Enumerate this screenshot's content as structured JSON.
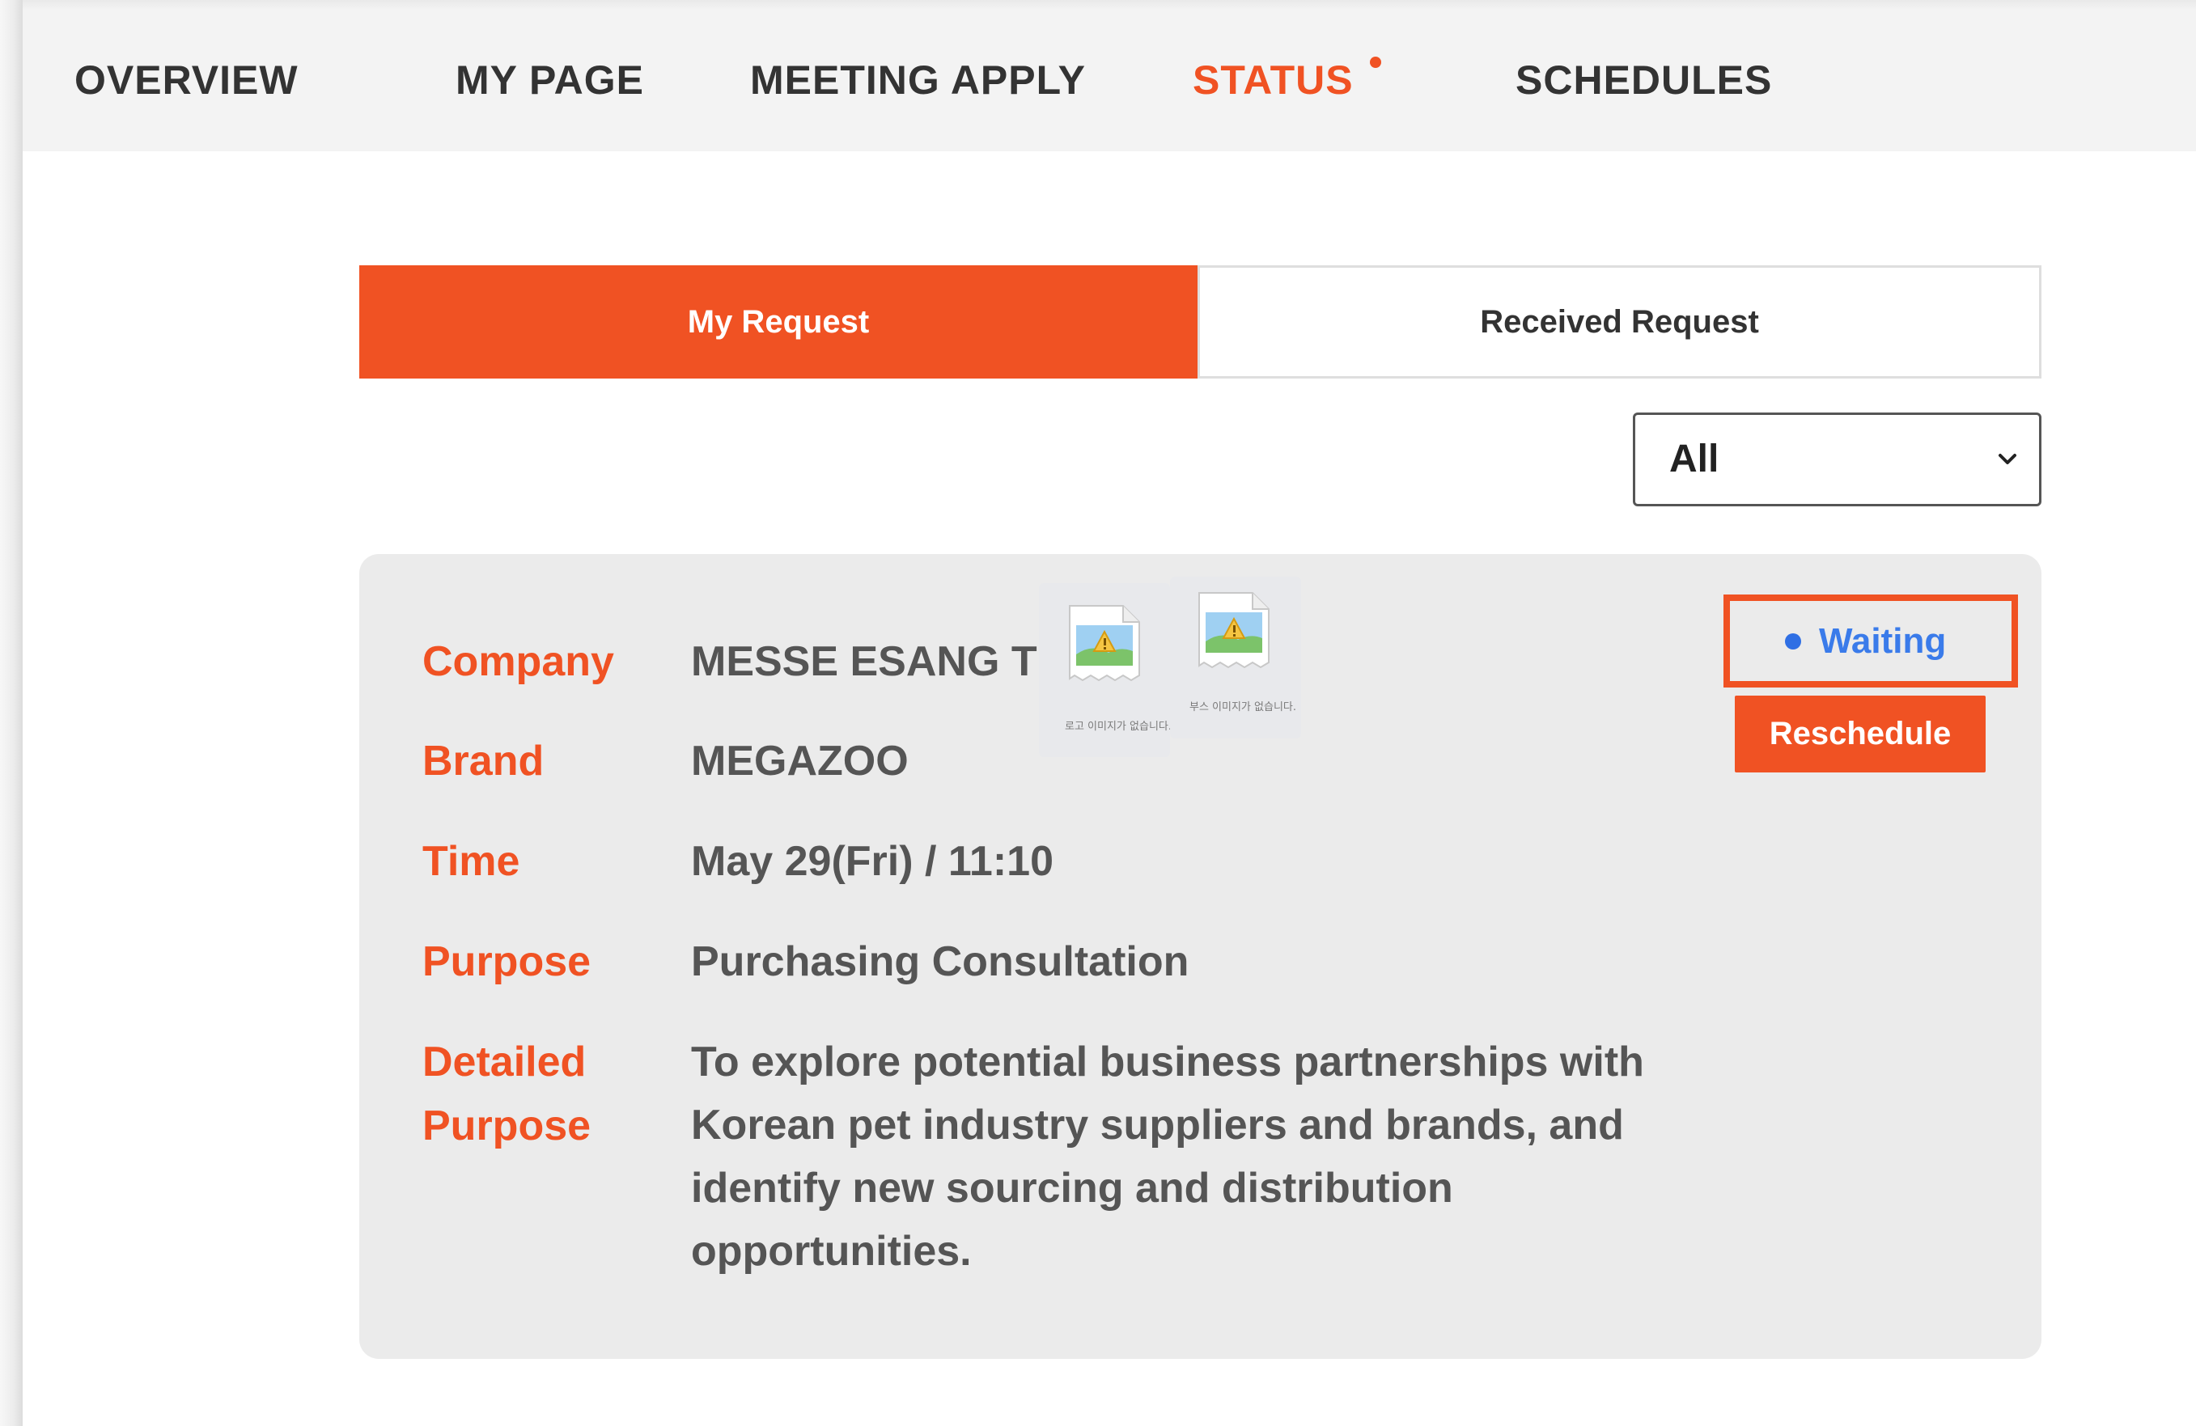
{
  "nav": {
    "items": [
      {
        "label": "OVERVIEW",
        "active": false
      },
      {
        "label": "MY PAGE",
        "active": false
      },
      {
        "label": "MEETING APPLY",
        "active": false
      },
      {
        "label": "STATUS",
        "active": true,
        "has_notification_dot": true
      },
      {
        "label": "SCHEDULES",
        "active": false
      }
    ]
  },
  "tabs": {
    "my_request": "My Request",
    "received_request": "Received Request",
    "active": "my_request"
  },
  "filter": {
    "selected": "All"
  },
  "request": {
    "labels": {
      "company": "Company",
      "brand": "Brand",
      "time": "Time",
      "purpose": "Purpose",
      "detailed_purpose_line1": "Detailed",
      "detailed_purpose_line2": "Purpose"
    },
    "values": {
      "company": "MESSE ESANG TES",
      "brand": "MEGAZOO",
      "time": "May 29(Fri) / 11:10",
      "purpose": "Purchasing Consultation",
      "detailed_purpose": "To explore potential business partnerships with Korean pet industry suppliers and brands, and identify new sourcing and distribution opportunities."
    },
    "broken_images": [
      {
        "icon": "broken-image-icon",
        "caption": "로고 이미지가 없습니다."
      },
      {
        "icon": "broken-image-icon",
        "caption": "부스 이미지가 없습니다."
      }
    ],
    "status": {
      "label": "Waiting",
      "dot_color": "#2f6fe4"
    },
    "reschedule_label": "Reschedule"
  },
  "colors": {
    "accent": "#f05223",
    "status_blue": "#3a7bea",
    "card_bg": "#ebebeb",
    "nav_bg": "#f3f3f3"
  }
}
